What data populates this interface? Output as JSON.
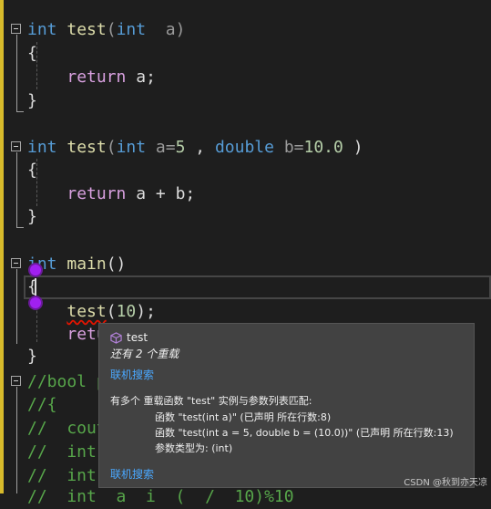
{
  "colors": {
    "keyword": "#569cd6",
    "function": "#dcdcaa",
    "control": "#d8a0df",
    "number": "#b5cea8",
    "comment": "#57a64a",
    "link": "#4aa8ff",
    "gutter_change": "#d7ba2b",
    "breakpoint_marker": "#a020f0"
  },
  "code": {
    "f1_kw": "int",
    "f1_name": "test",
    "f1_paren_open": "(",
    "f1_param_kw": "int",
    "f1_param": "  a",
    "f1_paren_close": ")",
    "f1_open_brace": "{",
    "f1_return": "return",
    "f1_return_expr": " a;",
    "f1_close_brace": "}",
    "f2_kw": "int",
    "f2_name": "test",
    "f2_paren_open": "(",
    "f2_param1_kw": "int",
    "f2_param1": " a=",
    "f2_param1_default": "5",
    "f2_sep": " , ",
    "f2_param2_kw": "double",
    "f2_param2": " b=",
    "f2_param2_default": "10.0",
    "f2_paren_close": " )",
    "f2_open_brace": "{",
    "f2_return": "return",
    "f2_return_expr": " a + b;",
    "f2_close_brace": "}",
    "main_kw": "int",
    "main_name": "main",
    "main_parens": "()",
    "main_open_brace": "{",
    "call_name": "test",
    "call_paren_open": "(",
    "call_arg": "10",
    "call_paren_close": ")",
    "call_semi": ";",
    "main_return": "retu",
    "main_close_brace": "}",
    "comment_lines": [
      "//bool p",
      "//{",
      "//  cout",
      "//  int",
      "//  int",
      "//  int  a  i  (  /  10)%10"
    ]
  },
  "tooltip": {
    "symbol": "test",
    "overloads": "还有 2 个重载",
    "search_link": "联机搜索",
    "message": "有多个 重载函数 \"test\" 实例与参数列表匹配:",
    "candidate1": "函数 \"test(int a)\" (已声明 所在行数:8)",
    "candidate2": "函数 \"test(int a = 5, double b = (10.0))\" (已声明 所在行数:13)",
    "arg_types": "参数类型为:  (int)",
    "search_link2": "联机搜索"
  },
  "watermark": "CSDN @秋到亦天凉"
}
